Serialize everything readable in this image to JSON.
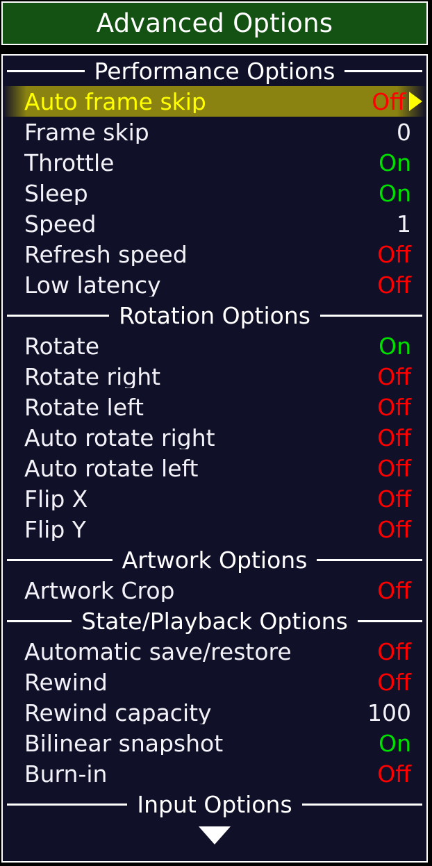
{
  "window": {
    "title": "Advanced Options",
    "title_bg": "#145214",
    "panel_bg": "#101028",
    "border_color": "#ffffff"
  },
  "colors": {
    "on": "#00e000",
    "off": "#ff0000",
    "number": "#f2f2f8",
    "selected_text": "#ffff00",
    "selected_bg": "#8a8211"
  },
  "menu": {
    "sections": [
      {
        "title": "Performance Options",
        "items": [
          {
            "label": "Auto frame skip",
            "value": "Off",
            "state": "off",
            "selected": true
          },
          {
            "label": "Frame skip",
            "value": "0",
            "state": "num",
            "selected": false
          },
          {
            "label": "Throttle",
            "value": "On",
            "state": "on",
            "selected": false
          },
          {
            "label": "Sleep",
            "value": "On",
            "state": "on",
            "selected": false
          },
          {
            "label": "Speed",
            "value": "1",
            "state": "num",
            "selected": false
          },
          {
            "label": "Refresh speed",
            "value": "Off",
            "state": "off",
            "selected": false
          },
          {
            "label": "Low latency",
            "value": "Off",
            "state": "off",
            "selected": false
          }
        ]
      },
      {
        "title": "Rotation Options",
        "items": [
          {
            "label": "Rotate",
            "value": "On",
            "state": "on",
            "selected": false
          },
          {
            "label": "Rotate right",
            "value": "Off",
            "state": "off",
            "selected": false
          },
          {
            "label": "Rotate left",
            "value": "Off",
            "state": "off",
            "selected": false
          },
          {
            "label": "Auto rotate right",
            "value": "Off",
            "state": "off",
            "selected": false
          },
          {
            "label": "Auto rotate left",
            "value": "Off",
            "state": "off",
            "selected": false
          },
          {
            "label": "Flip X",
            "value": "Off",
            "state": "off",
            "selected": false
          },
          {
            "label": "Flip Y",
            "value": "Off",
            "state": "off",
            "selected": false
          }
        ]
      },
      {
        "title": "Artwork Options",
        "items": [
          {
            "label": "Artwork Crop",
            "value": "Off",
            "state": "off",
            "selected": false
          }
        ]
      },
      {
        "title": "State/Playback Options",
        "items": [
          {
            "label": "Automatic save/restore",
            "value": "Off",
            "state": "off",
            "selected": false
          },
          {
            "label": "Rewind",
            "value": "Off",
            "state": "off",
            "selected": false
          },
          {
            "label": "Rewind capacity",
            "value": "100",
            "state": "num",
            "selected": false
          },
          {
            "label": "Bilinear snapshot",
            "value": "On",
            "state": "on",
            "selected": false
          },
          {
            "label": "Burn-in",
            "value": "Off",
            "state": "off",
            "selected": false
          }
        ]
      },
      {
        "title": "Input Options",
        "items": []
      }
    ],
    "scroll_down_indicator": true,
    "selected_arrow_icon": "arrow-right-icon",
    "scroll_down_icon": "arrow-down-icon"
  }
}
